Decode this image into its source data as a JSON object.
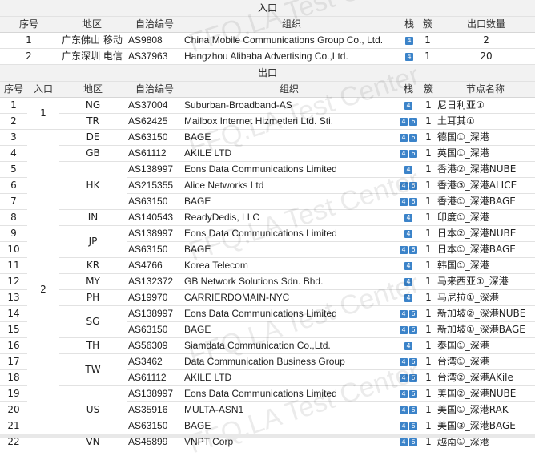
{
  "entrance": {
    "title": "入口",
    "headers": {
      "seq": "序号",
      "region": "地区",
      "as": "自治编号",
      "org": "组织",
      "stack": "栈",
      "cluster": "簇",
      "count": "出口数量"
    },
    "rows": [
      {
        "seq": "1",
        "region": "广东佛山 移动",
        "as": "AS9808",
        "org": "China Mobile Communications Group Co., Ltd.",
        "stack": [
          "4"
        ],
        "cluster": "1",
        "count": "2"
      },
      {
        "seq": "2",
        "region": "广东深圳 电信",
        "as": "AS37963",
        "org": "Hangzhou Alibaba Advertising Co.,Ltd.",
        "stack": [
          "4"
        ],
        "cluster": "1",
        "count": "20"
      }
    ]
  },
  "exit": {
    "title": "出口",
    "headers": {
      "seq": "序号",
      "entry": "入口",
      "region": "地区",
      "as": "自治编号",
      "org": "组织",
      "stack": "栈",
      "cluster": "簇",
      "node": "节点名称"
    },
    "entry_groups": [
      "1",
      "2"
    ],
    "rows": [
      {
        "seq": "1",
        "region": "NG",
        "as": "AS37004",
        "org": "Suburban-Broadband-AS",
        "stack": [
          "4"
        ],
        "cluster": "1",
        "node": "尼日利亚①"
      },
      {
        "seq": "2",
        "region": "TR",
        "as": "AS62425",
        "org": "Mailbox Internet Hizmetleri Ltd. Sti.",
        "stack": [
          "4",
          "6"
        ],
        "cluster": "1",
        "node": "土耳其①"
      },
      {
        "seq": "3",
        "region": "DE",
        "as": "AS63150",
        "org": "BAGE",
        "stack": [
          "4",
          "6"
        ],
        "cluster": "1",
        "node": "德国①_深港"
      },
      {
        "seq": "4",
        "region": "GB",
        "as": "AS61112",
        "org": "AKILE LTD",
        "stack": [
          "4",
          "6"
        ],
        "cluster": "1",
        "node": "英国①_深港"
      },
      {
        "seq": "5",
        "region": "",
        "as": "AS138997",
        "org": "Eons Data Communications Limited",
        "stack": [
          "4"
        ],
        "cluster": "1",
        "node": "香港②_深港NUBE"
      },
      {
        "seq": "6",
        "region": "HK",
        "as": "AS215355",
        "org": "Alice Networks Ltd",
        "stack": [
          "4",
          "6"
        ],
        "cluster": "1",
        "node": "香港③_深港ALICE"
      },
      {
        "seq": "7",
        "region": "",
        "as": "AS63150",
        "org": "BAGE",
        "stack": [
          "4",
          "6"
        ],
        "cluster": "1",
        "node": "香港①_深港BAGE"
      },
      {
        "seq": "8",
        "region": "IN",
        "as": "AS140543",
        "org": "ReadyDedis, LLC",
        "stack": [
          "4"
        ],
        "cluster": "1",
        "node": "印度①_深港"
      },
      {
        "seq": "9",
        "region": "JP",
        "as": "AS138997",
        "org": "Eons Data Communications Limited",
        "stack": [
          "4"
        ],
        "cluster": "1",
        "node": "日本②_深港NUBE"
      },
      {
        "seq": "10",
        "region": "",
        "as": "AS63150",
        "org": "BAGE",
        "stack": [
          "4",
          "6"
        ],
        "cluster": "1",
        "node": "日本①_深港BAGE"
      },
      {
        "seq": "11",
        "region": "KR",
        "as": "AS4766",
        "org": "Korea Telecom",
        "stack": [
          "4"
        ],
        "cluster": "1",
        "node": "韩国①_深港"
      },
      {
        "seq": "12",
        "region": "MY",
        "as": "AS132372",
        "org": "GB Network Solutions Sdn. Bhd.",
        "stack": [
          "4"
        ],
        "cluster": "1",
        "node": "马来西亚①_深港"
      },
      {
        "seq": "13",
        "region": "PH",
        "as": "AS19970",
        "org": "CARRIERDOMAIN-NYC",
        "stack": [
          "4"
        ],
        "cluster": "1",
        "node": "马尼拉①_深港"
      },
      {
        "seq": "14",
        "region": "SG",
        "as": "AS138997",
        "org": "Eons Data Communications Limited",
        "stack": [
          "4",
          "6"
        ],
        "cluster": "1",
        "node": "新加坡②_深港NUBE"
      },
      {
        "seq": "15",
        "region": "",
        "as": "AS63150",
        "org": "BAGE",
        "stack": [
          "4",
          "6"
        ],
        "cluster": "1",
        "node": "新加坡①_深港BAGE"
      },
      {
        "seq": "16",
        "region": "TH",
        "as": "AS56309",
        "org": "Siamdata Communication Co.,Ltd.",
        "stack": [
          "4"
        ],
        "cluster": "1",
        "node": "泰国①_深港"
      },
      {
        "seq": "17",
        "region": "TW",
        "as": "AS3462",
        "org": "Data Communication Business Group",
        "stack": [
          "4",
          "6"
        ],
        "cluster": "1",
        "node": "台湾①_深港"
      },
      {
        "seq": "18",
        "region": "",
        "as": "AS61112",
        "org": "AKILE LTD",
        "stack": [
          "4",
          "6"
        ],
        "cluster": "1",
        "node": "台湾②_深港AKile"
      },
      {
        "seq": "19",
        "region": "",
        "as": "AS138997",
        "org": "Eons Data Communications Limited",
        "stack": [
          "4",
          "6"
        ],
        "cluster": "1",
        "node": "美国②_深港NUBE"
      },
      {
        "seq": "20",
        "region": "US",
        "as": "AS35916",
        "org": "MULTA-ASN1",
        "stack": [
          "4",
          "6"
        ],
        "cluster": "1",
        "node": "美国①_深港RAK"
      },
      {
        "seq": "21",
        "region": "",
        "as": "AS63150",
        "org": "BAGE",
        "stack": [
          "4",
          "6"
        ],
        "cluster": "1",
        "node": "美国③_深港BAGE"
      },
      {
        "seq": "22",
        "region": "VN",
        "as": "AS45899",
        "org": "VNPT Corp",
        "stack": [
          "4",
          "6"
        ],
        "cluster": "1",
        "node": "越南①_深港"
      }
    ]
  },
  "watermark": "FFQ.LA Test Center",
  "colors": {
    "badge": "#3b83c9",
    "header_bg": "#f2f2f2"
  }
}
